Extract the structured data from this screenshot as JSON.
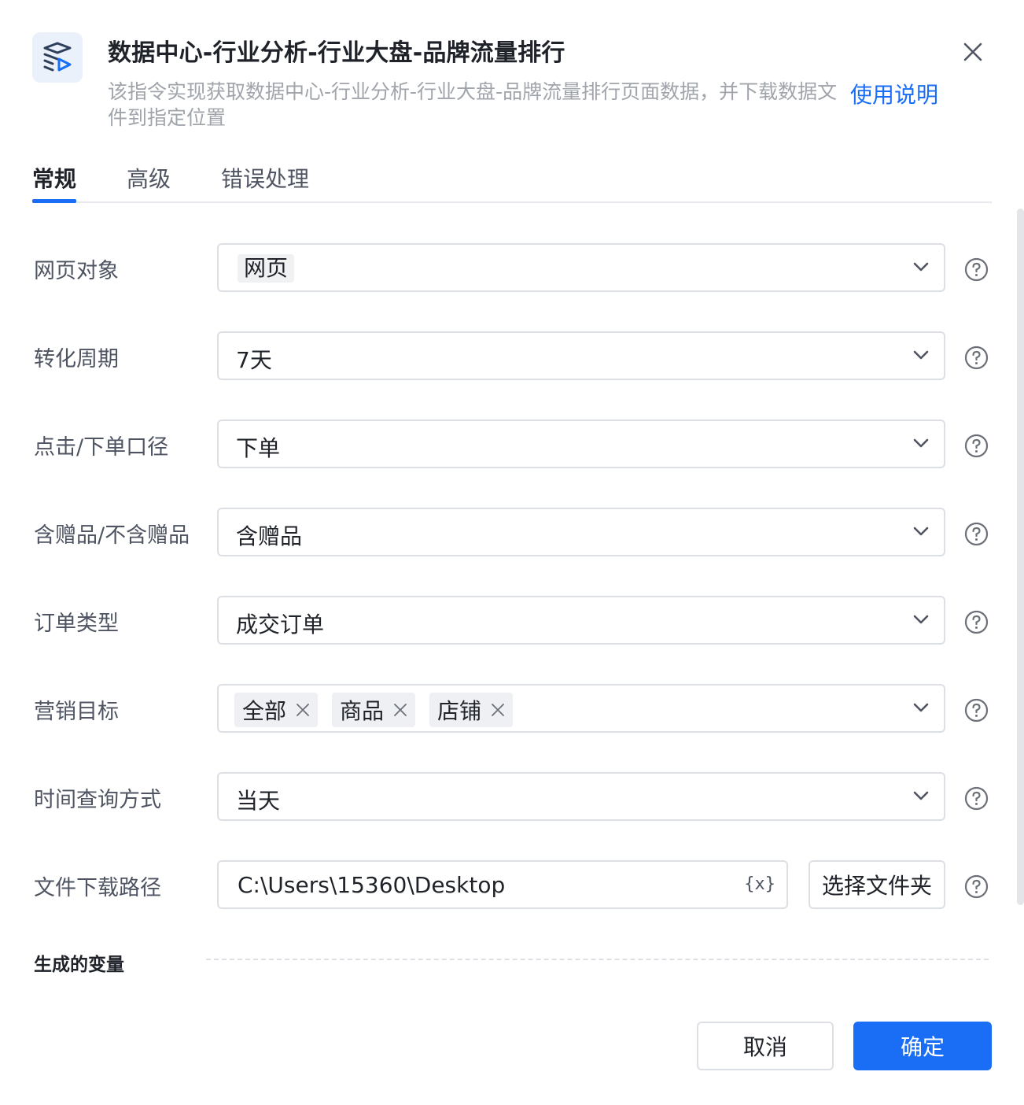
{
  "header": {
    "icon": "robot-flow-icon",
    "title": "数据中心-行业分析-行业大盘-品牌流量排行",
    "description": "该指令实现获取数据中心-行业分析-行业大盘-品牌流量排行页面数据，并下载数据文件到指定位置",
    "help_link": "使用说明"
  },
  "tabs": [
    {
      "label": "常规",
      "active": true
    },
    {
      "label": "高级",
      "active": false
    },
    {
      "label": "错误处理",
      "active": false
    }
  ],
  "form": {
    "web_object": {
      "label": "网页对象",
      "value": "网页"
    },
    "conversion_period": {
      "label": "转化周期",
      "value": "7天"
    },
    "click_order_scope": {
      "label": "点击/下单口径",
      "value": "下单"
    },
    "gift_option": {
      "label": "含赠品/不含赠品",
      "value": "含赠品"
    },
    "order_type": {
      "label": "订单类型",
      "value": "成交订单"
    },
    "marketing_target": {
      "label": "营销目标",
      "tags": [
        "全部",
        "商品",
        "店铺"
      ]
    },
    "time_query": {
      "label": "时间查询方式",
      "value": "当天"
    },
    "download_path": {
      "label": "文件下载路径",
      "value": "C:\\Users\\15360\\Desktop",
      "var_button": "{x}",
      "folder_button": "选择文件夹"
    }
  },
  "generated_vars": {
    "title": "生成的变量"
  },
  "footer": {
    "cancel": "取消",
    "confirm": "确定"
  },
  "colors": {
    "primary": "#1a6ef5",
    "border": "#dcdfe4",
    "muted_text": "#a0a4ab"
  }
}
